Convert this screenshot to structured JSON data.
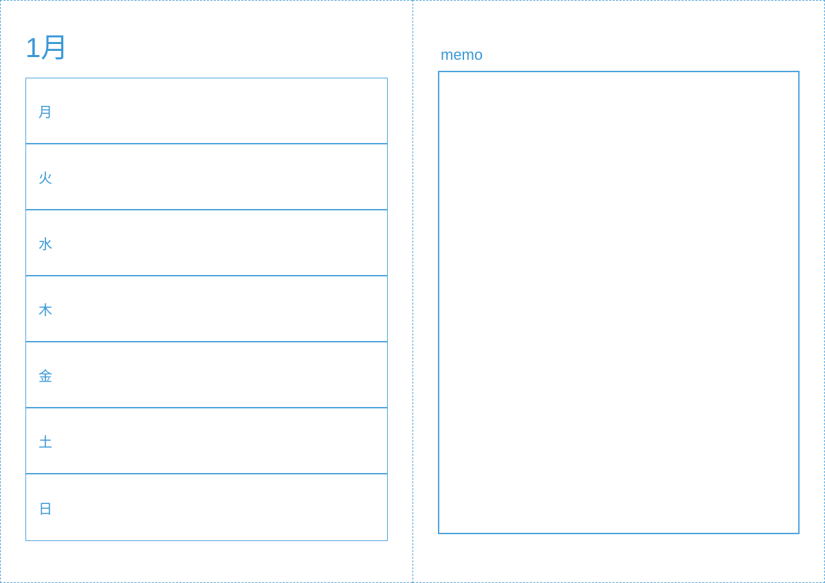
{
  "colors": {
    "accent": "#3a98d8",
    "border": "#4da3dd",
    "background": "#ffffff"
  },
  "planner": {
    "month_title": "1月",
    "days": [
      {
        "label": "月"
      },
      {
        "label": "火"
      },
      {
        "label": "水"
      },
      {
        "label": "木"
      },
      {
        "label": "金"
      },
      {
        "label": "土"
      },
      {
        "label": "日"
      }
    ]
  },
  "memo": {
    "label": "memo"
  }
}
